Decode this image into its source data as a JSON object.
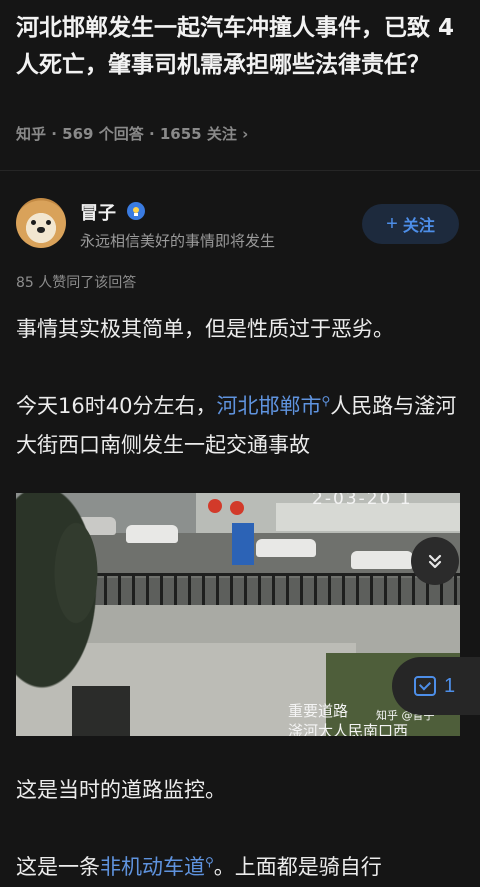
{
  "question": {
    "title": "河北邯郸发生一起汽车冲撞人事件，已致 4 人死亡，肇事司机需承担哪些法律责任？",
    "site": "知乎",
    "answers": "569 个回答",
    "followers": "1655 关注",
    "meta_separator": " · ",
    "chevron": "›"
  },
  "author": {
    "name": "冒子",
    "bio": "永远相信美好的事情即将发生",
    "badge_icon": "badge-icon",
    "follow_label": "关注",
    "follow_plus": "+"
  },
  "answer": {
    "likes": "85 人赞同了该回答",
    "p1": "事情其实极其简单，但是性质过于恶劣。",
    "p2_before": "今天16时40分左右，",
    "p2_link": "河北邯郸市",
    "p2_after": "人民路与滏河大街西口南侧发生一起交通事故",
    "p3": "这是当时的道路监控。",
    "p4_before": "这是一条",
    "p4_link": "非机动车道",
    "p4_after": "。上面都是骑自行",
    "search_glyph": "⚲"
  },
  "video": {
    "timestamp": "2-03-20 1",
    "caption_line1": "重要道路",
    "caption_line2": "滏河大人民南口西",
    "watermark": "知乎 @冒子"
  },
  "controls": {
    "collapse_icon": "chevron-double-down-icon",
    "collapse_glyph": "⌄",
    "collect_count": "1"
  },
  "colors": {
    "background": "#151515",
    "link": "#5f93de",
    "accent": "#4d8ee8"
  }
}
